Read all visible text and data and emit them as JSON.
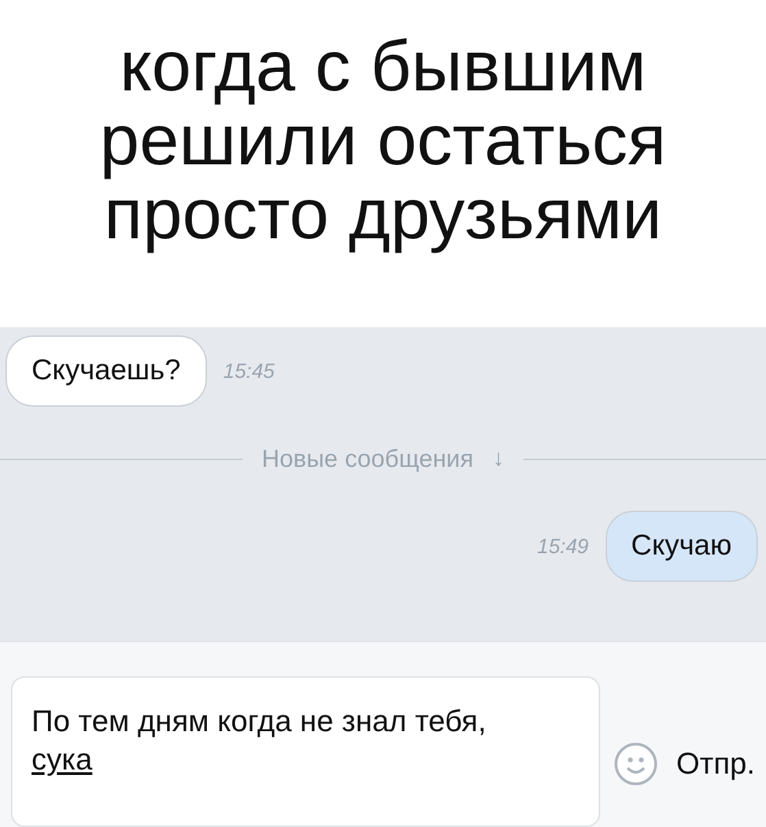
{
  "caption": [
    "когда с бывшим",
    "решили остаться",
    "просто друзьями"
  ],
  "messages": [
    {
      "kind": "message",
      "outgoing": false,
      "text": "Скучаешь?",
      "time": "15:45"
    },
    {
      "kind": "divider",
      "text": "Новые сообщения",
      "icon": "↓"
    },
    {
      "kind": "message",
      "outgoing": true,
      "text": "Скучаю",
      "time": "15:49"
    }
  ],
  "composer": {
    "value_parts": [
      {
        "text": "По тем дням когда не знал тебя, ",
        "underlined": false
      },
      {
        "text": "сука",
        "underlined": true
      }
    ],
    "send": "Отпр."
  }
}
